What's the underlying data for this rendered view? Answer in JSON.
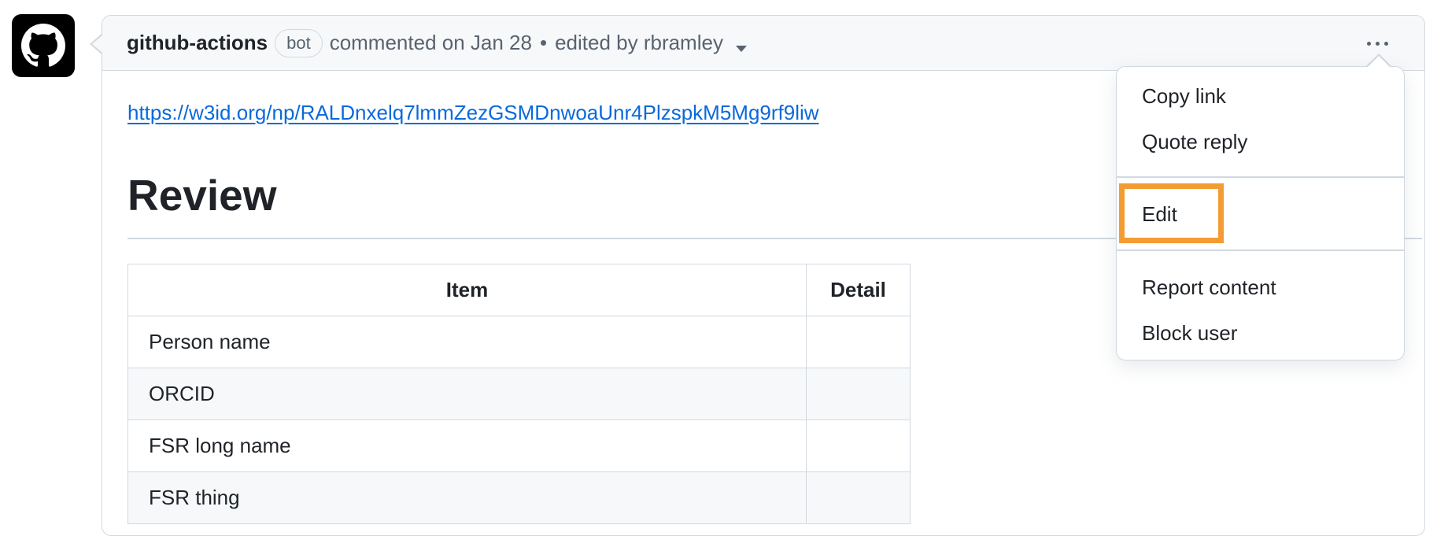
{
  "comment": {
    "author": "github-actions",
    "author_badge": "bot",
    "meta_text": "commented on Jan 28",
    "edited_text": "edited by rbramley",
    "link_text": "https://w3id.org/np/RALDnxelq7lmmZezGSMDnwoaUnr4PlzspkM5Mg9rf9liw",
    "heading": "Review"
  },
  "table": {
    "headers": [
      "Item",
      "Detail"
    ],
    "rows": [
      {
        "item": "Person name",
        "detail": ""
      },
      {
        "item": "ORCID",
        "detail": ""
      },
      {
        "item": "FSR long name",
        "detail": ""
      },
      {
        "item": "FSR thing",
        "detail": ""
      }
    ]
  },
  "menu": {
    "copy_link": "Copy link",
    "quote_reply": "Quote reply",
    "edit": "Edit",
    "report_content": "Report content",
    "block_user": "Block user"
  },
  "icons": {
    "avatar": "github-mark-icon",
    "more": "kebab-horizontal-icon",
    "edit_history": "triangle-down-icon"
  },
  "colors": {
    "link": "#0969da",
    "highlight": "#f39c33",
    "border": "#d1d9e0"
  }
}
